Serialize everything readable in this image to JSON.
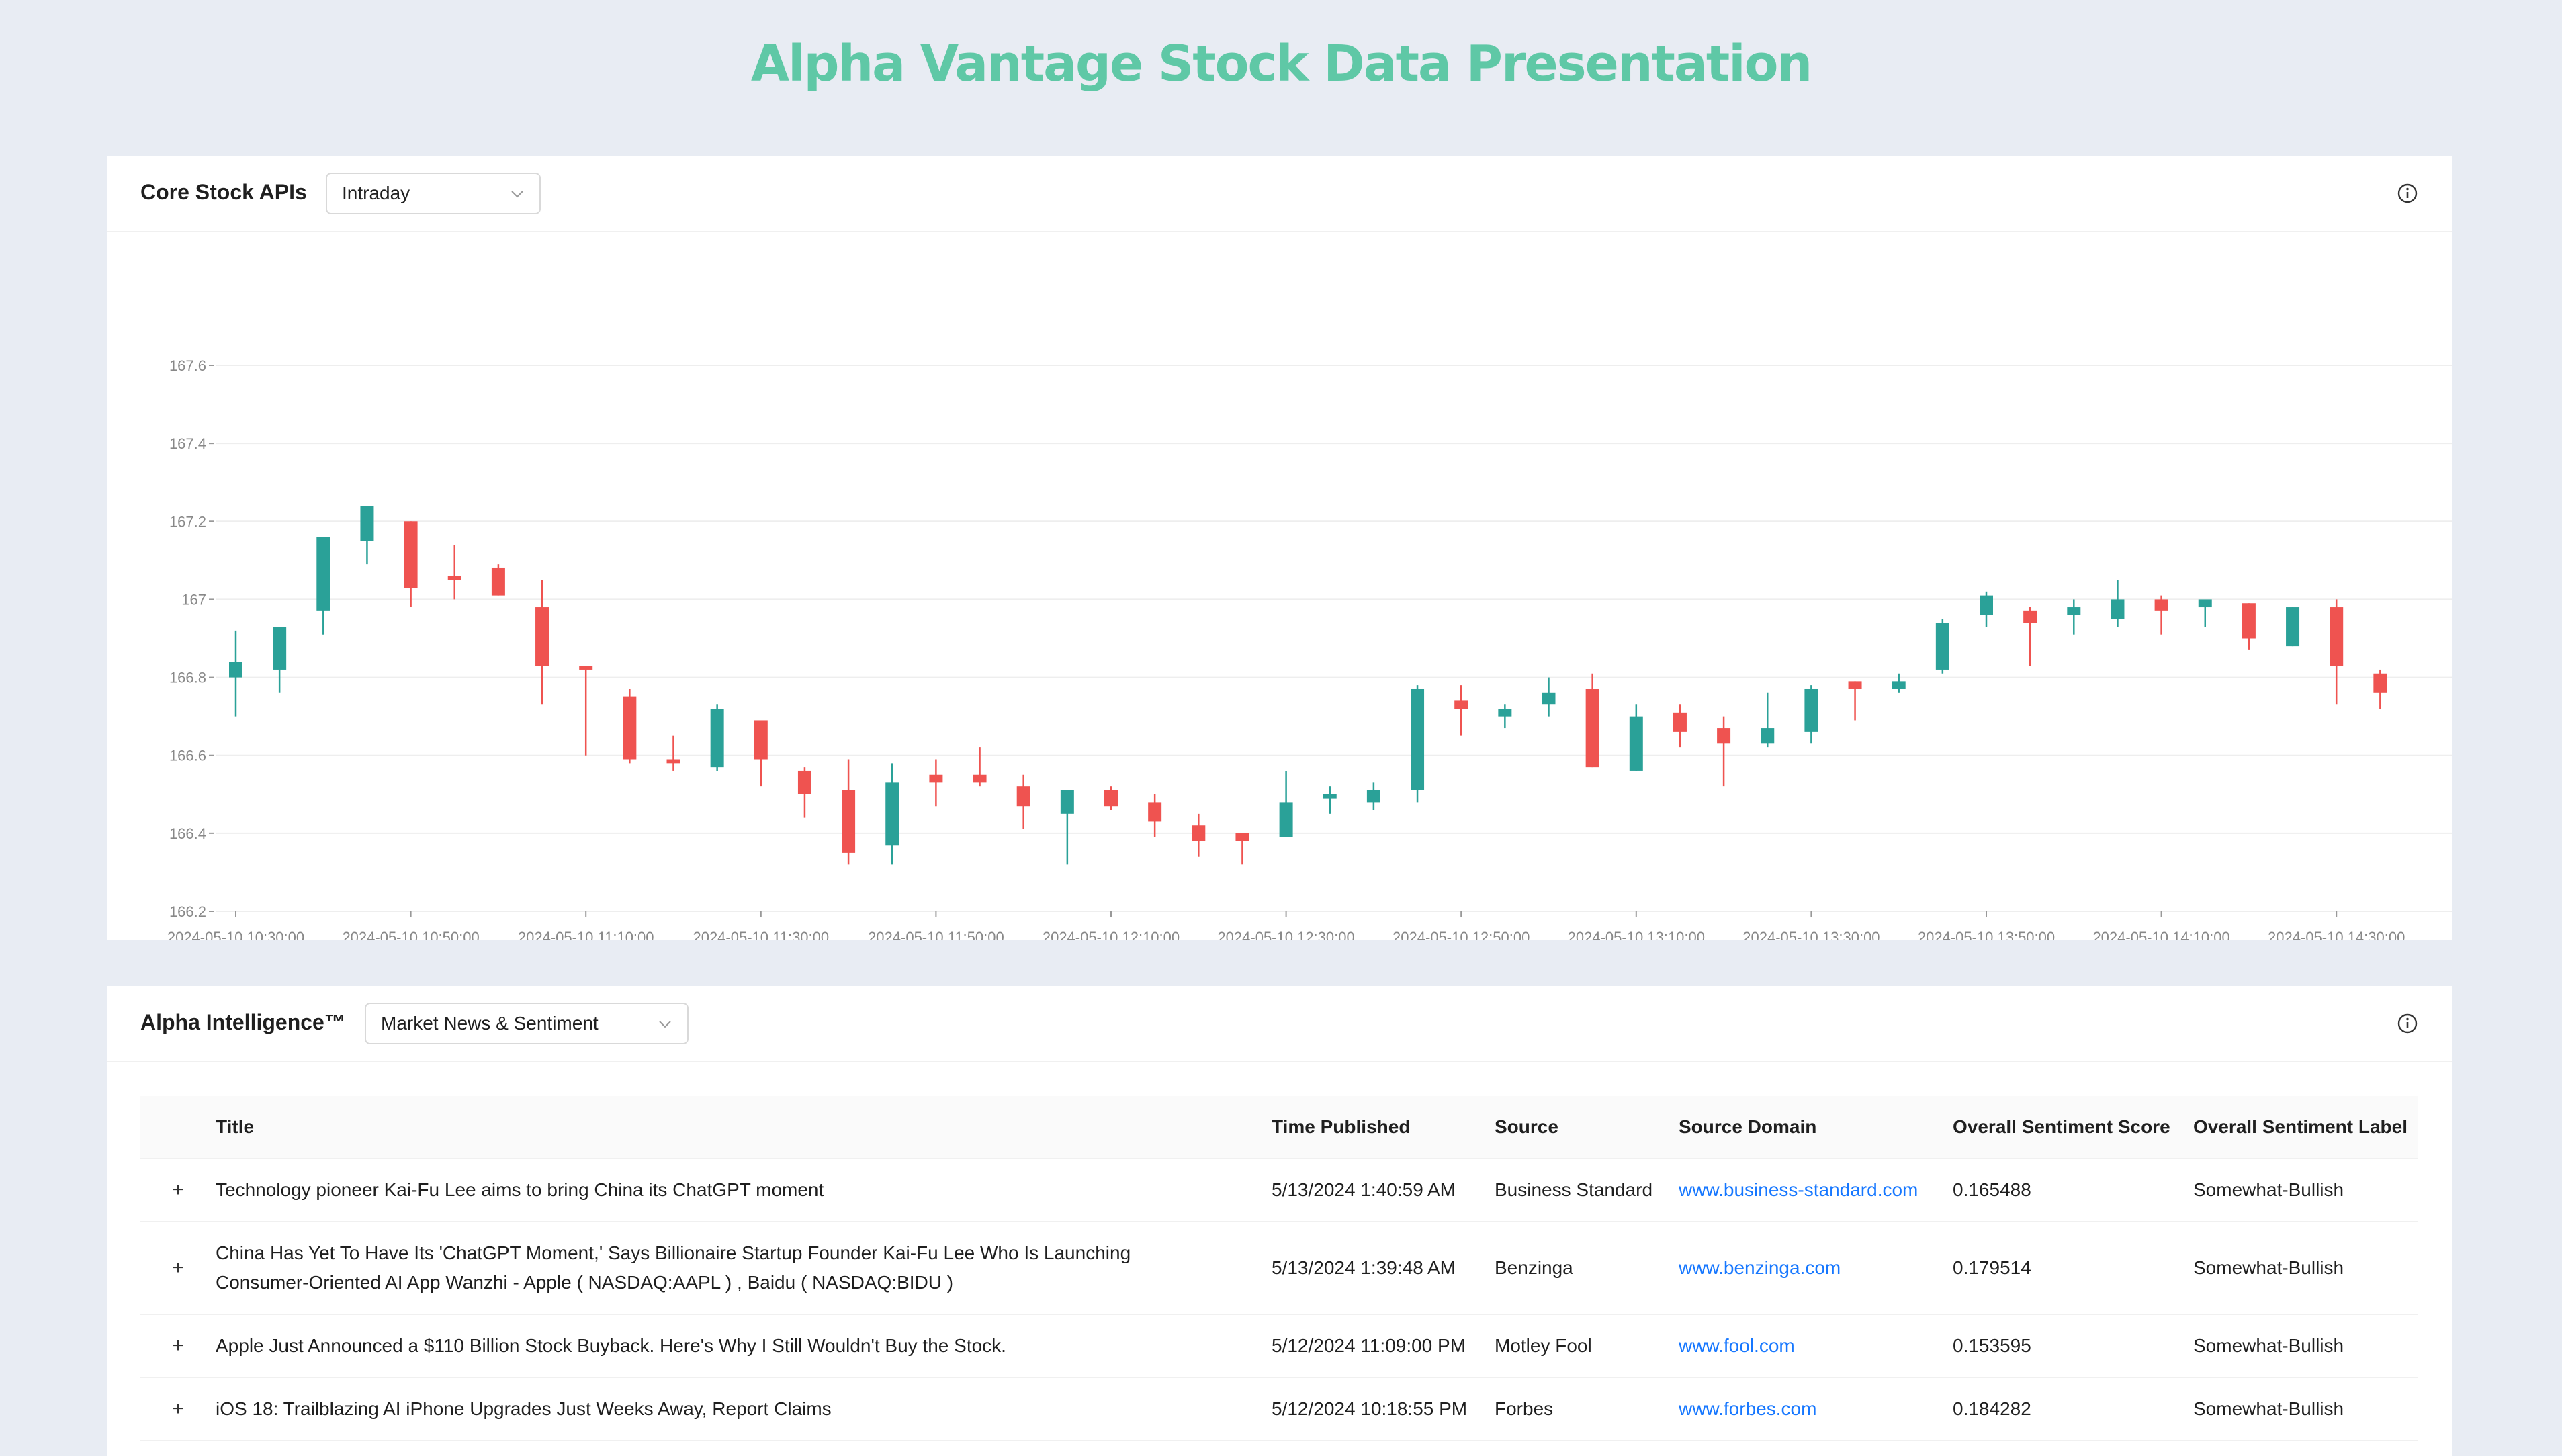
{
  "header": {
    "title": "Alpha Vantage Stock Data Presentation"
  },
  "core_card": {
    "title": "Core Stock APIs",
    "select_value": "Intraday"
  },
  "intel_card": {
    "title": "Alpha Intelligence™",
    "select_value": "Market News & Sentiment"
  },
  "icons": {
    "info": "info-circle-icon",
    "chevron": "chevron-down-icon",
    "expand": "plus-icon"
  },
  "colors": {
    "up": "#2aa198",
    "down": "#ef5350",
    "title": "#5fc8a6",
    "link": "#1677ff"
  },
  "chart_data": {
    "type": "candlestick",
    "title": "",
    "xlabel": "",
    "ylabel": "",
    "ylim": [
      166.2,
      167.6
    ],
    "yticks": [
      "167.6",
      "167.4",
      "167.2",
      "167",
      "166.8",
      "166.6",
      "166.4",
      "166.2"
    ],
    "ytick_values": [
      167.6,
      167.4,
      167.2,
      167.0,
      166.8,
      166.6,
      166.4,
      166.2
    ],
    "xtick_labels": [
      "2024-05-10 10:30:00",
      "2024-05-10 10:50:00",
      "2024-05-10 11:10:00",
      "2024-05-10 11:30:00",
      "2024-05-10 11:50:00",
      "2024-05-10 12:10:00",
      "2024-05-10 12:30:00",
      "2024-05-10 12:50:00",
      "2024-05-10 13:10:00",
      "2024-05-10 13:30:00",
      "2024-05-10 13:50:00",
      "2024-05-10 14:10:00",
      "2024-05-10 14:30:00"
    ],
    "grid": true,
    "candles": [
      {
        "o": 166.8,
        "h": 166.92,
        "l": 166.7,
        "c": 166.84
      },
      {
        "o": 166.82,
        "h": 166.93,
        "l": 166.76,
        "c": 166.93
      },
      {
        "o": 166.97,
        "h": 167.16,
        "l": 166.91,
        "c": 167.16
      },
      {
        "o": 167.15,
        "h": 167.24,
        "l": 167.09,
        "c": 167.24
      },
      {
        "o": 167.2,
        "h": 167.2,
        "l": 166.98,
        "c": 167.03
      },
      {
        "o": 167.06,
        "h": 167.14,
        "l": 167.0,
        "c": 167.05
      },
      {
        "o": 167.08,
        "h": 167.09,
        "l": 167.01,
        "c": 167.01
      },
      {
        "o": 166.98,
        "h": 167.05,
        "l": 166.73,
        "c": 166.83
      },
      {
        "o": 166.83,
        "h": 166.83,
        "l": 166.6,
        "c": 166.82
      },
      {
        "o": 166.75,
        "h": 166.77,
        "l": 166.58,
        "c": 166.59
      },
      {
        "o": 166.59,
        "h": 166.65,
        "l": 166.56,
        "c": 166.58
      },
      {
        "o": 166.57,
        "h": 166.73,
        "l": 166.56,
        "c": 166.72
      },
      {
        "o": 166.69,
        "h": 166.69,
        "l": 166.52,
        "c": 166.59
      },
      {
        "o": 166.56,
        "h": 166.57,
        "l": 166.44,
        "c": 166.5
      },
      {
        "o": 166.51,
        "h": 166.59,
        "l": 166.32,
        "c": 166.35
      },
      {
        "o": 166.37,
        "h": 166.58,
        "l": 166.32,
        "c": 166.53
      },
      {
        "o": 166.55,
        "h": 166.59,
        "l": 166.47,
        "c": 166.53
      },
      {
        "o": 166.55,
        "h": 166.62,
        "l": 166.52,
        "c": 166.53
      },
      {
        "o": 166.52,
        "h": 166.55,
        "l": 166.41,
        "c": 166.47
      },
      {
        "o": 166.45,
        "h": 166.51,
        "l": 166.32,
        "c": 166.51
      },
      {
        "o": 166.51,
        "h": 166.52,
        "l": 166.46,
        "c": 166.47
      },
      {
        "o": 166.48,
        "h": 166.5,
        "l": 166.39,
        "c": 166.43
      },
      {
        "o": 166.42,
        "h": 166.45,
        "l": 166.34,
        "c": 166.38
      },
      {
        "o": 166.4,
        "h": 166.4,
        "l": 166.32,
        "c": 166.38
      },
      {
        "o": 166.39,
        "h": 166.56,
        "l": 166.39,
        "c": 166.48
      },
      {
        "o": 166.49,
        "h": 166.52,
        "l": 166.45,
        "c": 166.5
      },
      {
        "o": 166.48,
        "h": 166.53,
        "l": 166.46,
        "c": 166.51
      },
      {
        "o": 166.51,
        "h": 166.78,
        "l": 166.48,
        "c": 166.77
      },
      {
        "o": 166.74,
        "h": 166.78,
        "l": 166.65,
        "c": 166.72
      },
      {
        "o": 166.7,
        "h": 166.73,
        "l": 166.67,
        "c": 166.72
      },
      {
        "o": 166.73,
        "h": 166.8,
        "l": 166.7,
        "c": 166.76
      },
      {
        "o": 166.77,
        "h": 166.81,
        "l": 166.57,
        "c": 166.57
      },
      {
        "o": 166.56,
        "h": 166.73,
        "l": 166.56,
        "c": 166.7
      },
      {
        "o": 166.71,
        "h": 166.73,
        "l": 166.62,
        "c": 166.66
      },
      {
        "o": 166.67,
        "h": 166.7,
        "l": 166.52,
        "c": 166.63
      },
      {
        "o": 166.63,
        "h": 166.76,
        "l": 166.62,
        "c": 166.67
      },
      {
        "o": 166.66,
        "h": 166.78,
        "l": 166.63,
        "c": 166.77
      },
      {
        "o": 166.79,
        "h": 166.79,
        "l": 166.69,
        "c": 166.77
      },
      {
        "o": 166.77,
        "h": 166.81,
        "l": 166.76,
        "c": 166.79
      },
      {
        "o": 166.82,
        "h": 166.95,
        "l": 166.81,
        "c": 166.94
      },
      {
        "o": 166.96,
        "h": 167.02,
        "l": 166.93,
        "c": 167.01
      },
      {
        "o": 166.97,
        "h": 166.98,
        "l": 166.83,
        "c": 166.94
      },
      {
        "o": 166.96,
        "h": 167.0,
        "l": 166.91,
        "c": 166.98
      },
      {
        "o": 166.95,
        "h": 167.05,
        "l": 166.93,
        "c": 167.0
      },
      {
        "o": 167.0,
        "h": 167.01,
        "l": 166.91,
        "c": 166.97
      },
      {
        "o": 166.98,
        "h": 166.99,
        "l": 166.93,
        "c": 167.0
      },
      {
        "o": 166.99,
        "h": 166.99,
        "l": 166.87,
        "c": 166.9
      },
      {
        "o": 166.88,
        "h": 166.98,
        "l": 166.88,
        "c": 166.98
      },
      {
        "o": 166.98,
        "h": 167.0,
        "l": 166.73,
        "c": 166.83
      },
      {
        "o": 166.81,
        "h": 166.82,
        "l": 166.72,
        "c": 166.76
      }
    ]
  },
  "news_table": {
    "columns": [
      "Title",
      "Time Published",
      "Source",
      "Source Domain",
      "Overall Sentiment Score",
      "Overall Sentiment Label"
    ],
    "rows": [
      {
        "expand": "+",
        "title": "Technology pioneer Kai-Fu Lee aims to bring China its ChatGPT moment",
        "time": "5/13/2024 1:40:59 AM",
        "source": "Business Standard",
        "domain": "www.business-standard.com",
        "score": "0.165488",
        "label": "Somewhat-Bullish"
      },
      {
        "expand": "+",
        "title": "China Has Yet To Have Its 'ChatGPT Moment,' Says Billionaire Startup Founder Kai-Fu Lee Who Is Launching Consumer-Oriented AI App Wanzhi - Apple ( NASDAQ:AAPL ) , Baidu ( NASDAQ:BIDU )",
        "time": "5/13/2024 1:39:48 AM",
        "source": "Benzinga",
        "domain": "www.benzinga.com",
        "score": "0.179514",
        "label": "Somewhat-Bullish"
      },
      {
        "expand": "+",
        "title": "Apple Just Announced a $110 Billion Stock Buyback. Here's Why I Still Wouldn't Buy the Stock.",
        "time": "5/12/2024 11:09:00 PM",
        "source": "Motley Fool",
        "domain": "www.fool.com",
        "score": "0.153595",
        "label": "Somewhat-Bullish"
      },
      {
        "expand": "+",
        "title": "iOS 18: Trailblazing AI iPhone Upgrades Just Weeks Away, Report Claims",
        "time": "5/12/2024 10:18:55 PM",
        "source": "Forbes",
        "domain": "www.forbes.com",
        "score": "0.184282",
        "label": "Somewhat-Bullish"
      }
    ]
  }
}
